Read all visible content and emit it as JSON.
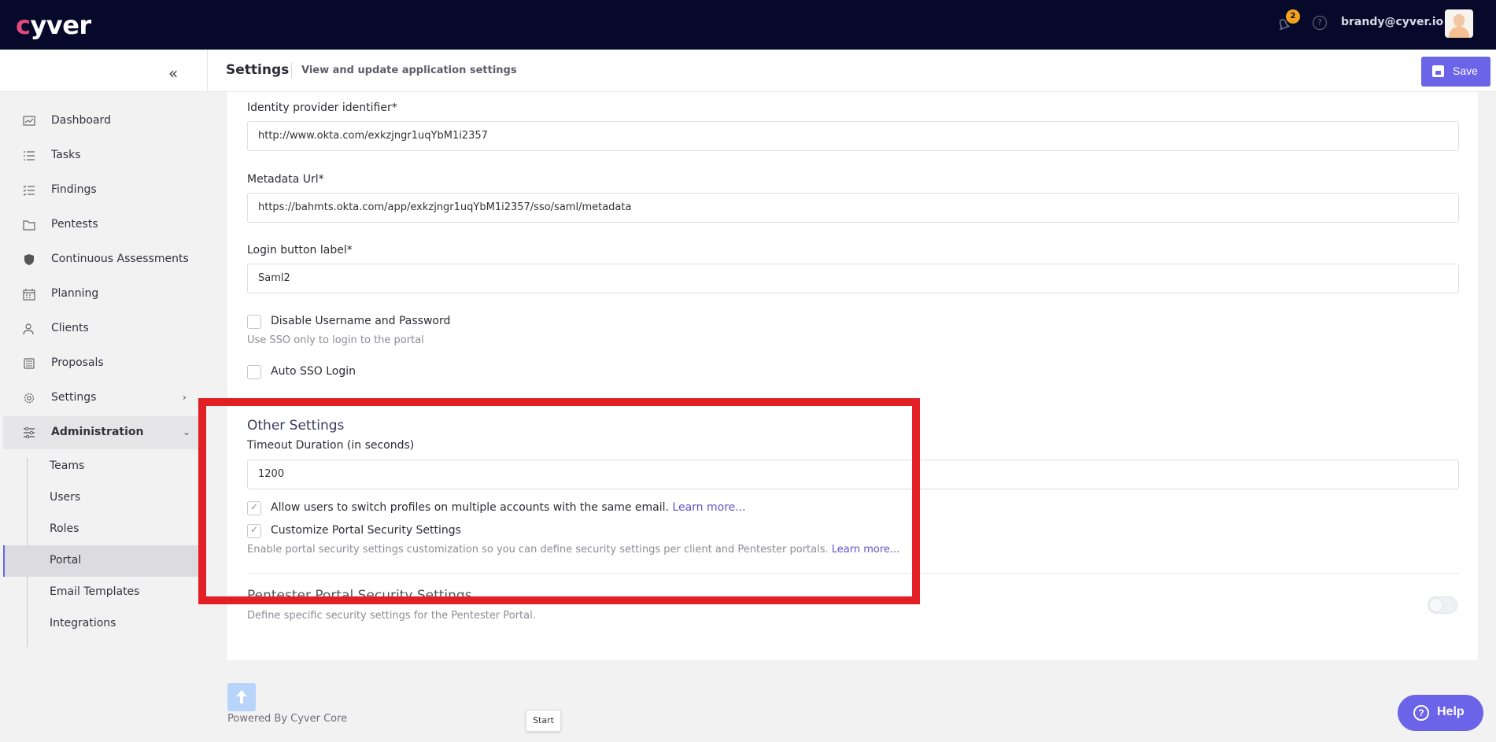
{
  "app": {
    "logo": "cyver",
    "notification_count": "2",
    "user_email": "brandy@cyver.io"
  },
  "header": {
    "title": "Settings",
    "subtitle": "View and update application settings",
    "save_label": "Save"
  },
  "sidebar": {
    "items": [
      {
        "label": "Dashboard",
        "icon": "chart-icon"
      },
      {
        "label": "Tasks",
        "icon": "list-icon"
      },
      {
        "label": "Findings",
        "icon": "checklist-icon"
      },
      {
        "label": "Pentests",
        "icon": "folder-icon"
      },
      {
        "label": "Continuous Assessments",
        "icon": "shield-icon"
      },
      {
        "label": "Planning",
        "icon": "calendar-icon"
      },
      {
        "label": "Clients",
        "icon": "users-icon"
      },
      {
        "label": "Proposals",
        "icon": "stack-icon"
      },
      {
        "label": "Settings",
        "icon": "gear-icon"
      },
      {
        "label": "Administration",
        "icon": "sliders-icon"
      }
    ],
    "admin_children": [
      "Teams",
      "Users",
      "Roles",
      "Portal",
      "Email Templates",
      "Integrations"
    ]
  },
  "form": {
    "idp_label": "Identity provider identifier*",
    "idp_value": "http://www.okta.com/exkzjngr1uqYbM1i2357",
    "metadata_label": "Metadata Url*",
    "metadata_value": "https://bahmts.okta.com/app/exkzjngr1uqYbM1i2357/sso/saml/metadata",
    "login_button_label": "Login button label*",
    "login_button_value": "Saml2",
    "disable_userpass_label": "Disable Username and Password",
    "disable_userpass_help": "Use SSO only to login to the portal",
    "auto_sso_label": "Auto SSO Login",
    "other_settings_title": "Other Settings",
    "timeout_label": "Timeout Duration (in seconds)",
    "timeout_value": "1200",
    "switch_profiles_label": "Allow users to switch profiles on multiple accounts with the same email.",
    "learn_more": "Learn more...",
    "customize_portal_label": "Customize Portal Security Settings",
    "customize_portal_help": "Enable portal security settings customization so you can define security settings per client and Pentester portals.",
    "pentester_title": "Pentester Portal Security Settings",
    "pentester_help": "Define specific security settings for the Pentester Portal."
  },
  "footer": {
    "powered": "Powered By Cyver Core",
    "tooltip": "Start",
    "help_label": "Help"
  }
}
